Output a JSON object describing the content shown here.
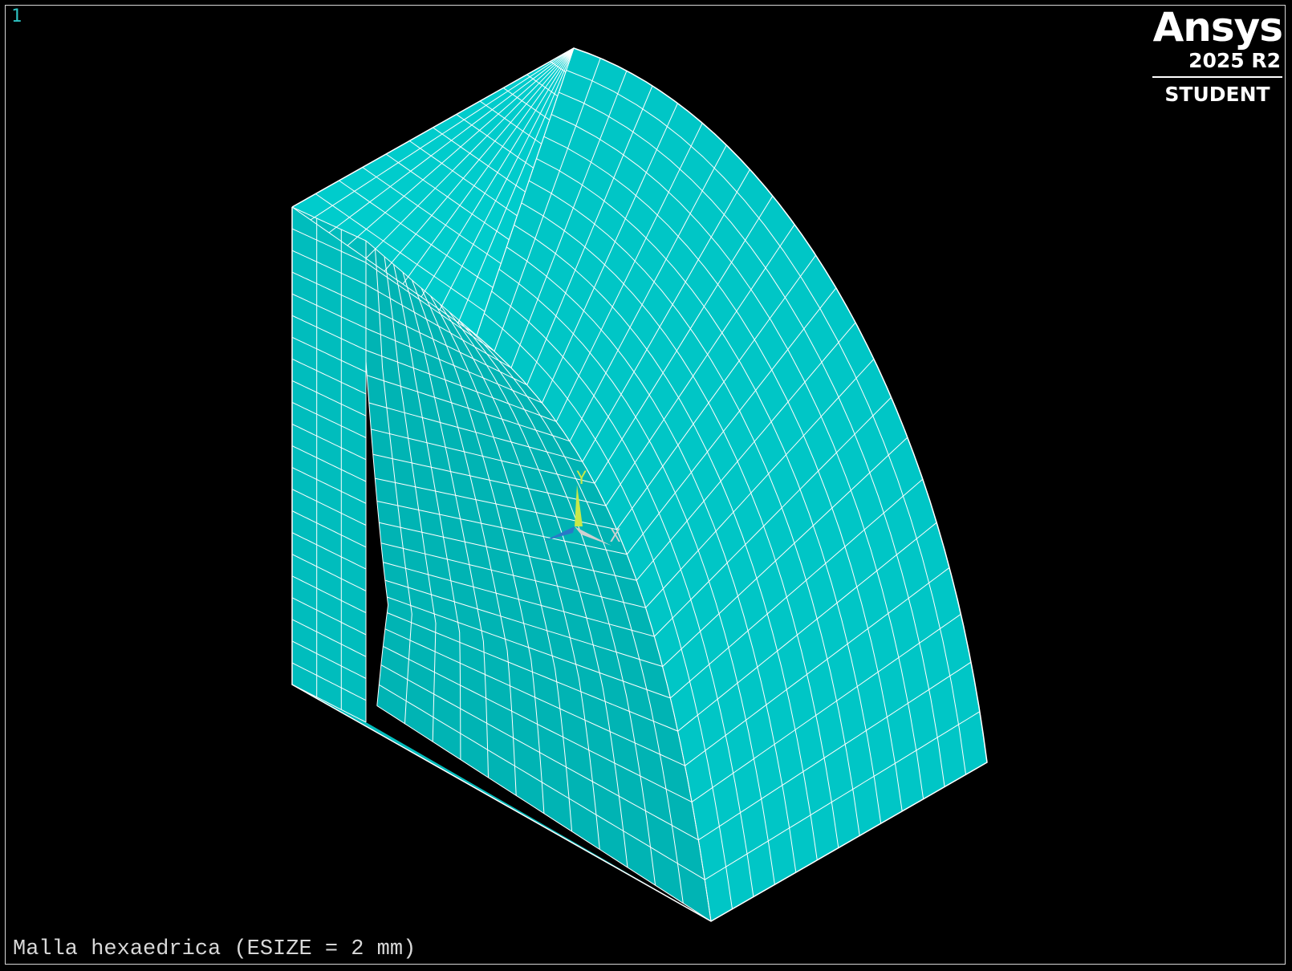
{
  "viewport": {
    "window_number": "1",
    "plot_title": "Malla hexaedrica (ESIZE = 2 mm)",
    "background_color": "#000000",
    "frame_color": "#d8d8d8",
    "window_number_color": "#2ec4c4"
  },
  "logo": {
    "name": "Ansys",
    "version": "2025 R2",
    "edition": "STUDENT",
    "color": "#ffffff"
  },
  "triad": {
    "y_label": "Y",
    "x_label": "X",
    "y_color": "#c8e84a",
    "x_color": "#d0d0d0",
    "z_color": "#2a78c8"
  },
  "mesh": {
    "element_type": "hexahedral",
    "fill_color": "#00cccc",
    "top_face_color": "#00cccc",
    "curved_face_color": "#00c6c6",
    "inner_face_color": "#00b4b4",
    "left_face_color": "#00bdbd",
    "line_color": "#ffffff"
  }
}
